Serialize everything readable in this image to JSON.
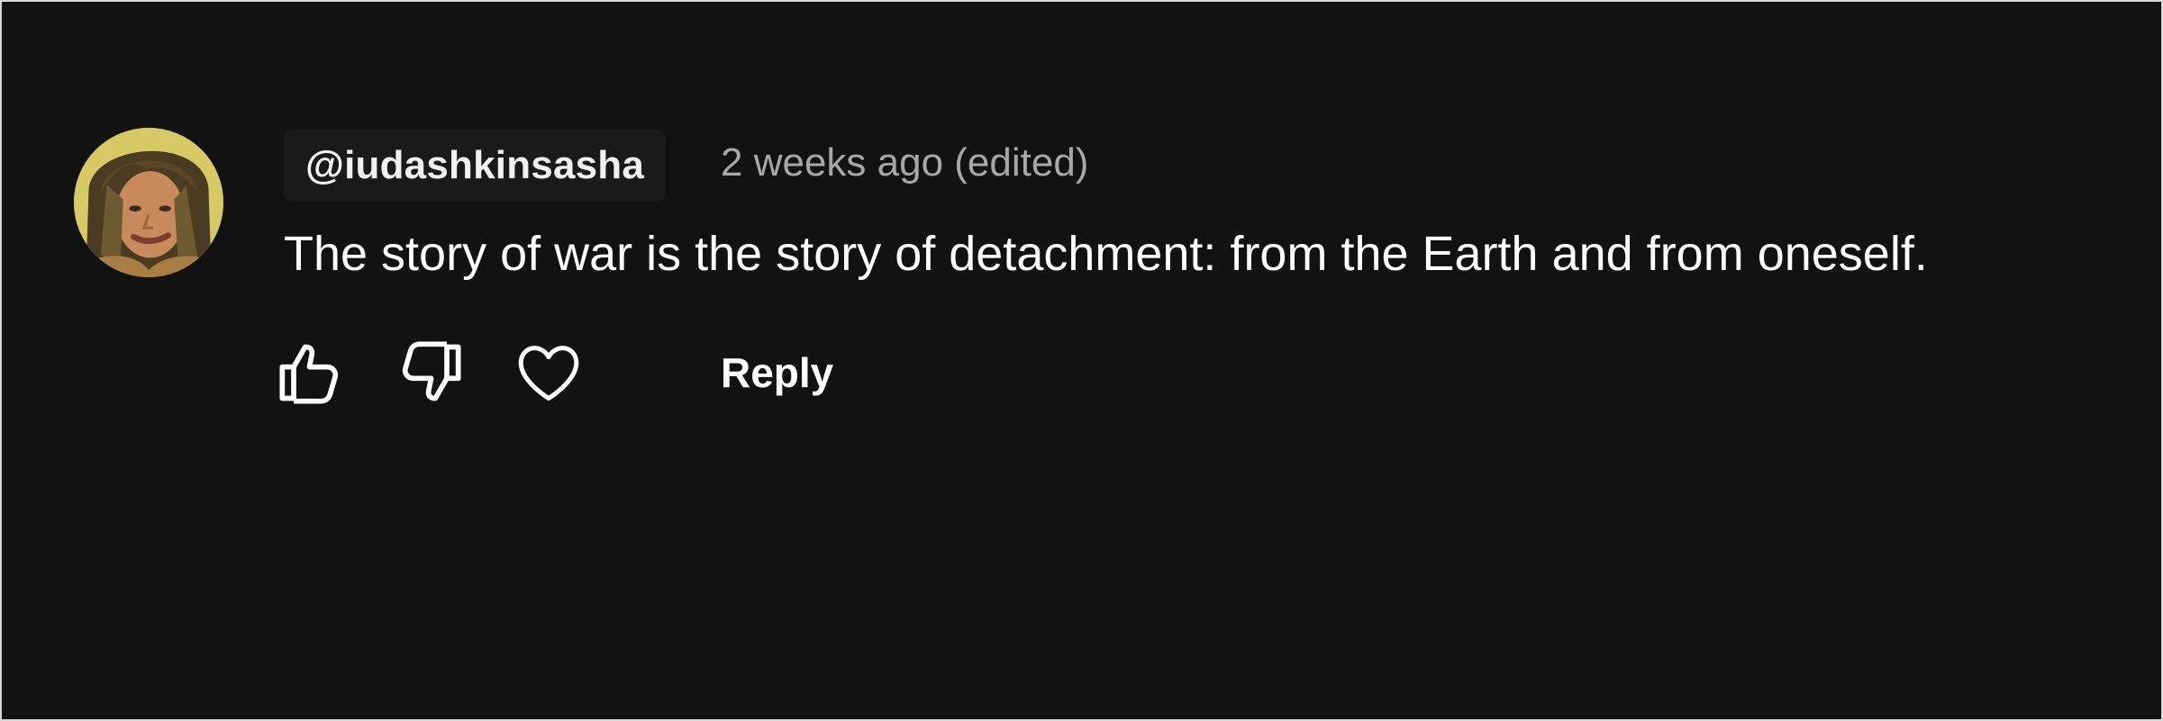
{
  "comment": {
    "author": "@iudashkinsasha",
    "timestamp": "2 weeks ago (edited)",
    "text": "The story of war is the story of detachment: from the Earth and from oneself.",
    "reply_label": "Reply"
  },
  "icons": {
    "like": "thumbs-up-icon",
    "dislike": "thumbs-down-icon",
    "heart": "heart-icon"
  },
  "colors": {
    "background": "#121212",
    "primary_text": "#f1f1f1",
    "secondary_text": "#a8a8a8",
    "author_chip": "#1a1a1a"
  }
}
